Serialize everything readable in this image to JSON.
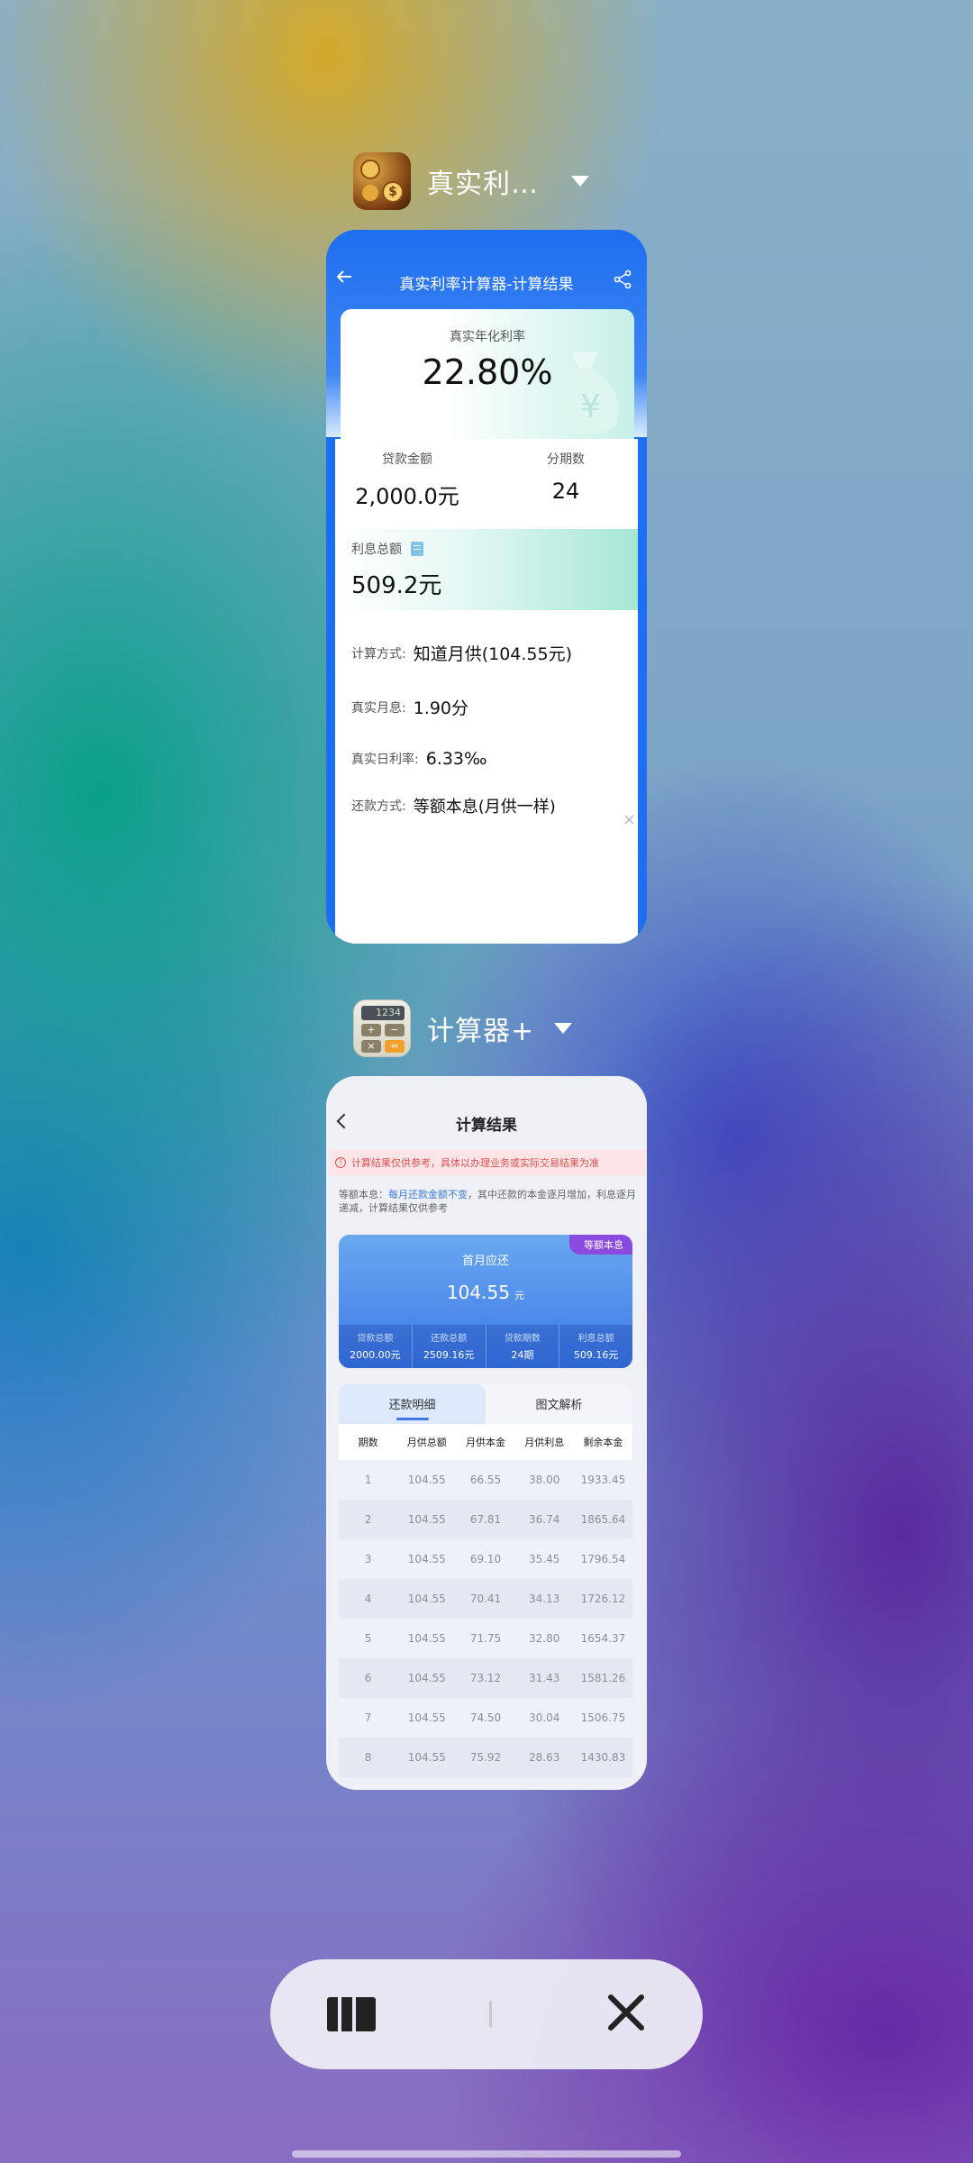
{
  "app1": {
    "name": "真实利…",
    "icon": "money-icon"
  },
  "card1": {
    "title": "真实利率计算器-计算结果",
    "rate_label": "真实年化利率",
    "rate_value": "22.80%",
    "loan_label": "贷款金额",
    "loan_value": "2,000.0元",
    "periods_label": "分期数",
    "periods_value": "24",
    "interest_label": "利息总额",
    "interest_value": "509.2元",
    "method_label": "计算方式:",
    "method_value": "知道月供(104.55元)",
    "monthly_label": "真实月息:",
    "monthly_value": "1.90分",
    "daily_label": "真实日利率:",
    "daily_value": "6.33‰",
    "repay_label": "还款方式:",
    "repay_value": "等额本息(月供一样)"
  },
  "app2": {
    "name": "计算器+",
    "icon": "calculator-icon",
    "display": "1234"
  },
  "card2": {
    "title": "计算结果",
    "notice": "计算结果仅供参考，具体以办理业务或实际交易结果为准",
    "desc_prefix": "等额本息：",
    "desc_highlight": "每月还款金额不变",
    "desc_rest": "，其中还款的本金逐月增加，利息逐月递减，计算结果仅供参考",
    "badge": "等额本息",
    "first_label": "首月应还",
    "first_value": "104.55",
    "first_unit": "元",
    "stats": [
      {
        "label": "贷款总额",
        "value": "2000.00元"
      },
      {
        "label": "还款总额",
        "value": "2509.16元"
      },
      {
        "label": "贷款期数",
        "value": "24期"
      },
      {
        "label": "利息总额",
        "value": "509.16元"
      }
    ],
    "tabs": [
      "还款明细",
      "图文解析"
    ],
    "headers": [
      "期数",
      "月供总额",
      "月供本金",
      "月供利息",
      "剩余本金"
    ],
    "rows": [
      [
        "1",
        "104.55",
        "66.55",
        "38.00",
        "1933.45"
      ],
      [
        "2",
        "104.55",
        "67.81",
        "36.74",
        "1865.64"
      ],
      [
        "3",
        "104.55",
        "69.10",
        "35.45",
        "1796.54"
      ],
      [
        "4",
        "104.55",
        "70.41",
        "34.13",
        "1726.12"
      ],
      [
        "5",
        "104.55",
        "71.75",
        "32.80",
        "1654.37"
      ],
      [
        "6",
        "104.55",
        "73.12",
        "31.43",
        "1581.26"
      ],
      [
        "7",
        "104.55",
        "74.50",
        "30.04",
        "1506.75"
      ],
      [
        "8",
        "104.55",
        "75.92",
        "28.63",
        "1430.83"
      ]
    ]
  },
  "dock": {
    "split_icon": "split-screen-icon",
    "close_icon": "close-all-icon"
  }
}
